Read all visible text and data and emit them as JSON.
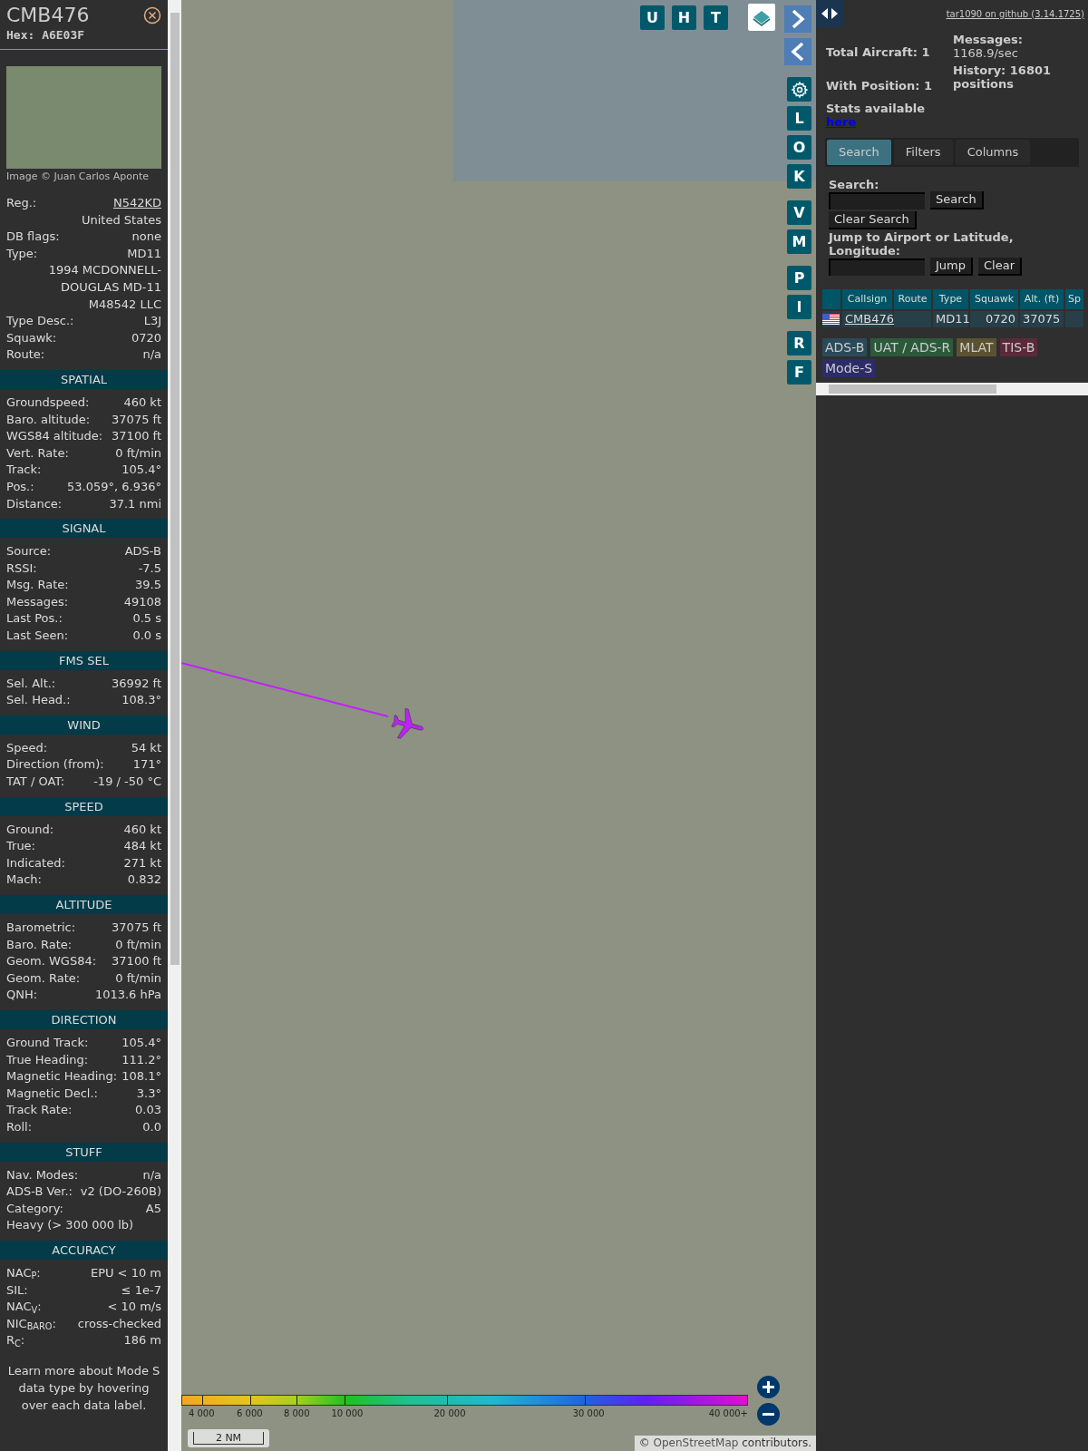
{
  "detail": {
    "callsign": "CMB476",
    "hex": "Hex: A6E03F",
    "photo_credit": "Image © Juan Carlos Aponte",
    "rows": [
      {
        "kind": "link",
        "label": "Reg.:",
        "value": "N542KD"
      },
      {
        "kind": "value",
        "value": "United States"
      },
      {
        "kind": "pair",
        "label": "DB flags:",
        "value": "none"
      },
      {
        "kind": "pair",
        "label": "Type:",
        "value": "MD11"
      },
      {
        "kind": "value",
        "value": "1994 MCDONNELL-DOUGLAS MD-11"
      },
      {
        "kind": "value",
        "value": "M48542 LLC"
      },
      {
        "kind": "pair",
        "label": "Type Desc.:",
        "value": "L3J"
      },
      {
        "kind": "pair",
        "label": "Squawk:",
        "value": "0720"
      },
      {
        "kind": "pair",
        "label": "Route:",
        "value": "n/a"
      }
    ],
    "sections": [
      {
        "title": "SPATIAL",
        "rows": [
          {
            "kind": "pair",
            "label": "Groundspeed:",
            "value": "460 kt"
          },
          {
            "kind": "pair",
            "label": "Baro. altitude:",
            "value": "37075 ft"
          },
          {
            "kind": "pair",
            "label": "WGS84 altitude:",
            "value": "37100 ft"
          },
          {
            "kind": "pair",
            "label": "Vert. Rate:",
            "value": "0 ft/min"
          },
          {
            "kind": "pair",
            "label": "Track:",
            "value": "105.4°"
          },
          {
            "kind": "pair",
            "label": "Pos.:",
            "value": "53.059°, 6.936°"
          },
          {
            "kind": "pair",
            "label": "Distance:",
            "value": "37.1 nmi"
          }
        ]
      },
      {
        "title": "SIGNAL",
        "rows": [
          {
            "kind": "pair",
            "label": "Source:",
            "value": "ADS-B"
          },
          {
            "kind": "pair",
            "label": "RSSI:",
            "value": "-7.5"
          },
          {
            "kind": "pair",
            "label": "Msg. Rate:",
            "value": "39.5"
          },
          {
            "kind": "pair",
            "label": "Messages:",
            "value": "49108"
          },
          {
            "kind": "pair",
            "label": "Last Pos.:",
            "value": "0.5 s"
          },
          {
            "kind": "pair",
            "label": "Last Seen:",
            "value": "0.0 s"
          }
        ]
      },
      {
        "title": "FMS SEL",
        "rows": [
          {
            "kind": "pair",
            "label": "Sel. Alt.:",
            "value": "36992 ft"
          },
          {
            "kind": "pair",
            "label": "Sel. Head.:",
            "value": "108.3°"
          }
        ]
      },
      {
        "title": "WIND",
        "rows": [
          {
            "kind": "pair",
            "label": "Speed:",
            "value": "54 kt"
          },
          {
            "kind": "pair",
            "label": "Direction (from):",
            "value": "171°"
          },
          {
            "kind": "pair",
            "label": "TAT / OAT:",
            "value": "-19 / -50 °C"
          }
        ]
      },
      {
        "title": "SPEED",
        "rows": [
          {
            "kind": "pair",
            "label": "Ground:",
            "value": "460 kt"
          },
          {
            "kind": "pair",
            "label": "True:",
            "value": "484 kt"
          },
          {
            "kind": "pair",
            "label": "Indicated:",
            "value": "271 kt"
          },
          {
            "kind": "pair",
            "label": "Mach:",
            "value": "0.832"
          }
        ]
      },
      {
        "title": "ALTITUDE",
        "rows": [
          {
            "kind": "pair",
            "label": "Barometric:",
            "value": "37075 ft"
          },
          {
            "kind": "pair",
            "label": "Baro. Rate:",
            "value": "0 ft/min"
          },
          {
            "kind": "pair",
            "label": "Geom. WGS84:",
            "value": "37100 ft"
          },
          {
            "kind": "pair",
            "label": "Geom. Rate:",
            "value": "0 ft/min"
          },
          {
            "kind": "pair",
            "label": "QNH:",
            "value": "1013.6 hPa"
          }
        ]
      },
      {
        "title": "DIRECTION",
        "rows": [
          {
            "kind": "pair",
            "label": "Ground Track:",
            "value": "105.4°"
          },
          {
            "kind": "pair",
            "label": "True Heading:",
            "value": "111.2°"
          },
          {
            "kind": "pair",
            "label": "Magnetic Heading:",
            "value": "108.1°"
          },
          {
            "kind": "pair",
            "label": "Magnetic Decl.:",
            "value": "3.3°"
          },
          {
            "kind": "pair",
            "label": "Track Rate:",
            "value": "0.03"
          },
          {
            "kind": "pair",
            "label": "Roll:",
            "value": "0.0"
          }
        ]
      },
      {
        "title": "STUFF",
        "rows": [
          {
            "kind": "pair",
            "label": "Nav. Modes:",
            "value": "n/a"
          },
          {
            "kind": "pair",
            "label": "ADS-B Ver.:",
            "value": "v2 (DO-260B)"
          },
          {
            "kind": "pair",
            "label": "Category:",
            "value": "A5"
          },
          {
            "kind": "full",
            "value": "Heavy (> 300 000 lb)"
          }
        ]
      },
      {
        "title": "ACCURACY",
        "rows": [
          {
            "kind": "pair",
            "label": "NAC$_{P}$:",
            "value": "EPU < 10 m"
          },
          {
            "kind": "pair",
            "label": "SIL:",
            "value": "≤ 1e-7"
          },
          {
            "kind": "pair",
            "label": "NAC$_{V}$:",
            "value": "< 10 m/s"
          },
          {
            "kind": "pair",
            "label": "NIC$_{BARO}$:",
            "value": "cross-checked"
          },
          {
            "kind": "pair",
            "label": "R$_{C}$:",
            "value": "186 m"
          }
        ]
      }
    ],
    "footer": "Learn more about Mode S data type by hovering over each data label."
  },
  "map": {
    "top_buttons": [
      "U",
      "H",
      "T"
    ],
    "side_buttons": [
      "L",
      "O",
      "K",
      "V",
      "M",
      "P",
      "I",
      "R",
      "F"
    ],
    "legend": [
      "4 000",
      "6 000",
      "8 000",
      "10 000",
      "20 000",
      "30 000",
      "40 000+"
    ],
    "scale": "2 NM",
    "attribution": {
      "prefix": "©",
      "link": "OpenStreetMap",
      "suffix": "contributors."
    }
  },
  "sidebar": {
    "github_link": "tar1090 on github (3.14.1725)",
    "stats": {
      "total": "Total Aircraft: 1",
      "with_position": "With Position: 1",
      "stats_label": "Stats available",
      "stats_link": "here",
      "messages_label": "Messages:",
      "messages_value": "1168.9/sec",
      "history": "History: 16801 positions"
    },
    "tabs": [
      {
        "label": "Search",
        "selected": true
      },
      {
        "label": "Filters",
        "selected": false
      },
      {
        "label": "Columns",
        "selected": false
      }
    ],
    "search_label": "Search:",
    "search_button": "Search",
    "clear_search_button": "Clear Search",
    "jump_label": "Jump to Airport or Latitude, Longitude:",
    "jump_button": "Jump",
    "clear_button": "Clear",
    "table": {
      "columns": [
        "Callsign",
        "Route",
        "Type",
        "Squawk",
        "Alt. (ft)",
        "Sp"
      ],
      "rows": [
        {
          "callsign": "CMB476",
          "type": "MD11",
          "squawk": "0720",
          "altitude": "37075"
        }
      ]
    },
    "sources": [
      {
        "label": "ADS-B",
        "color": "#2a4a5a"
      },
      {
        "label": "UAT / ADS-R",
        "color": "#2b5a3a"
      },
      {
        "label": "MLAT",
        "color": "#5a5230"
      },
      {
        "label": "TIS-B",
        "color": "#5a2a3a"
      },
      {
        "label": "Mode-S",
        "color": "#2c2c6a"
      }
    ]
  }
}
